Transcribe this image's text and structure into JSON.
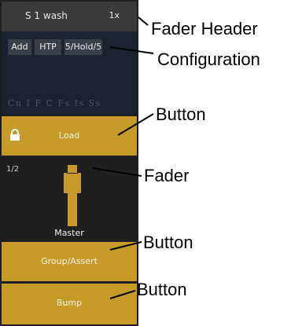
{
  "fader": {
    "header": {
      "name": "S 1 wash",
      "rate": "1x"
    },
    "config_buttons": [
      "Add",
      "HTP",
      "5/Hold/5"
    ],
    "flags": "Cn I F C Fs Is Ss",
    "load_label": "Load",
    "page": "1/2",
    "fader_name": "Master",
    "group_label": "Group/Assert",
    "bump_label": "Bump"
  },
  "annotations": {
    "fader_header": "Fader Header",
    "configuration": "Configuration",
    "button_1": "Button",
    "fader": "Fader",
    "button_2": "Button",
    "button_3": "Button"
  },
  "colors": {
    "gold": "#c79a2a",
    "panel": "#1f1f1f",
    "header": "#3a3a3a",
    "config_bg": "#1b2330"
  },
  "icons": {
    "lock": "lock-icon"
  }
}
